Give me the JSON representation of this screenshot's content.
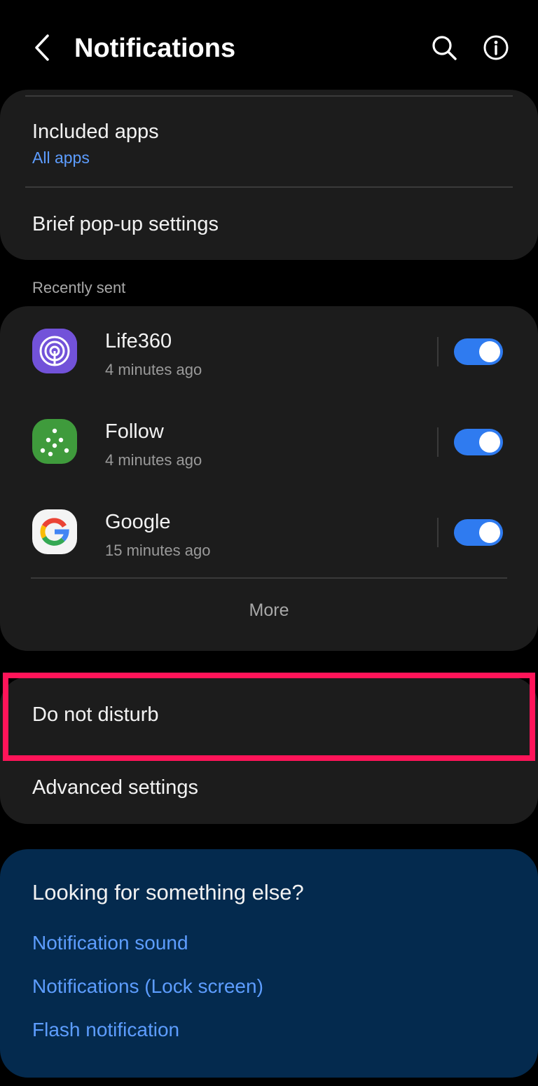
{
  "header": {
    "title": "Notifications",
    "back_icon": "back-arrow-icon",
    "search_icon": "search-icon",
    "info_icon": "info-icon"
  },
  "popup_card": {
    "included_apps_label": "Included apps",
    "included_apps_value": "All apps",
    "brief_popup_label": "Brief pop-up settings"
  },
  "recently_sent": {
    "section_label": "Recently sent",
    "apps": [
      {
        "name": "Life360",
        "time": "4 minutes ago",
        "enabled": true,
        "icon": "life360-icon"
      },
      {
        "name": "Follow",
        "time": "4 minutes ago",
        "enabled": true,
        "icon": "follow-icon"
      },
      {
        "name": "Google",
        "time": "15 minutes ago",
        "enabled": true,
        "icon": "google-icon"
      }
    ],
    "more_label": "More"
  },
  "settings_card": {
    "dnd_label": "Do not disturb",
    "advanced_label": "Advanced settings"
  },
  "suggestions": {
    "title": "Looking for something else?",
    "links": [
      "Notification sound",
      "Notifications (Lock screen)",
      "Flash notification"
    ]
  },
  "colors": {
    "background": "#000000",
    "card": "#1c1c1c",
    "accent_blue": "#5d9dff",
    "toggle_on": "#2f7bf0",
    "highlight": "#ff1459",
    "suggest_bg": "#042a4e"
  }
}
